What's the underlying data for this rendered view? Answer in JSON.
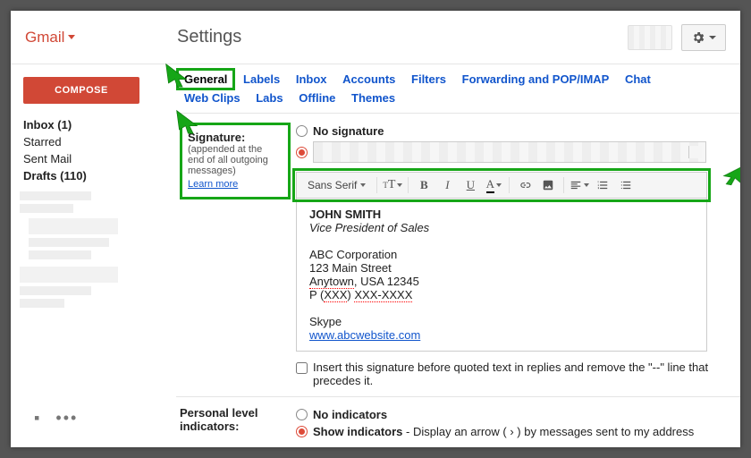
{
  "brand": "Gmail",
  "title": "Settings",
  "compose": "COMPOSE",
  "nav": {
    "inbox": "Inbox (1)",
    "starred": "Starred",
    "sent": "Sent Mail",
    "drafts": "Drafts (110)"
  },
  "tabs": {
    "general": "General",
    "labels": "Labels",
    "inbox": "Inbox",
    "accounts": "Accounts",
    "filters": "Filters",
    "forwarding": "Forwarding and POP/IMAP",
    "chat": "Chat",
    "webclips": "Web Clips",
    "labs": "Labs",
    "offline": "Offline",
    "themes": "Themes"
  },
  "signature": {
    "label": "Signature:",
    "sub": "(appended at the end of all outgoing messages)",
    "learn": "Learn more",
    "no_sig": "No signature",
    "font": "Sans Serif",
    "body": {
      "name": "JOHN SMITH",
      "title": "Vice President of Sales",
      "company": "ABC Corporation",
      "street": "123 Main Street",
      "city_a": "Anytown",
      "city_b": ", USA 12345",
      "phone_a": "P (",
      "phone_b": "XXX",
      "phone_c": ") ",
      "phone_d": "XXX-XXXX",
      "skype": "Skype",
      "url": "www.abcwebsite.com"
    },
    "insert_before": "Insert this signature before quoted text in replies and remove the \"--\" line that precedes it."
  },
  "indicators": {
    "label": "Personal level indicators:",
    "no": "No indicators",
    "show_a": "Show indicators",
    "show_b": " - Display an arrow ( › ) by messages sent to my address"
  }
}
